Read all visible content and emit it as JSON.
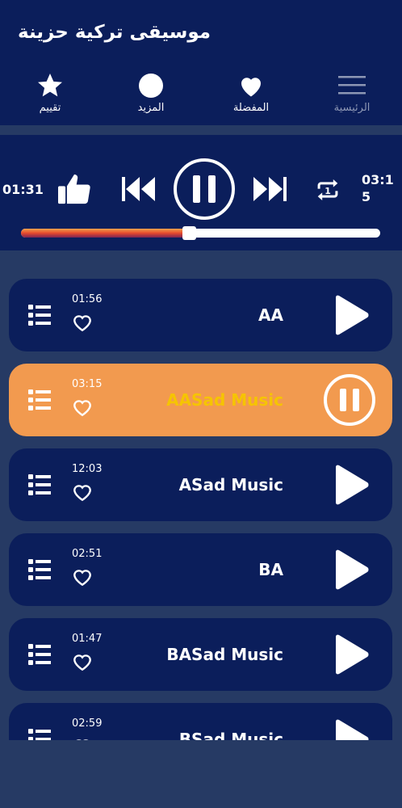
{
  "header": {
    "title": "موسيقى تركية حزينة"
  },
  "nav": [
    {
      "label": "تقييم",
      "icon": "star-icon",
      "active": true
    },
    {
      "label": "المزيد",
      "icon": "circle-icon",
      "active": true
    },
    {
      "label": "المفضلة",
      "icon": "heart-icon",
      "active": true
    },
    {
      "label": "الرئيسية",
      "icon": "hamburger-icon",
      "active": false
    }
  ],
  "player": {
    "elapsed": "01:31",
    "total": "03:15",
    "progress": 0.468,
    "colors": {
      "fill_top": "#f3a24c",
      "fill_mid": "#e64a2d",
      "fill_bottom": "#7a2456"
    }
  },
  "tracks": [
    {
      "duration": "01:56",
      "title": "AA",
      "playing": false
    },
    {
      "duration": "03:15",
      "title": "AASad Music",
      "playing": true
    },
    {
      "duration": "12:03",
      "title": "ASad Music",
      "playing": false
    },
    {
      "duration": "02:51",
      "title": "BA",
      "playing": false
    },
    {
      "duration": "01:47",
      "title": "BASad Music",
      "playing": false
    },
    {
      "duration": "02:59",
      "title": "BSad Music",
      "playing": false
    }
  ],
  "colors": {
    "header_bg": "#0b1e5b",
    "page_bg": "#263a64",
    "active_card": "#f29a4f",
    "active_title": "#f6c400"
  }
}
